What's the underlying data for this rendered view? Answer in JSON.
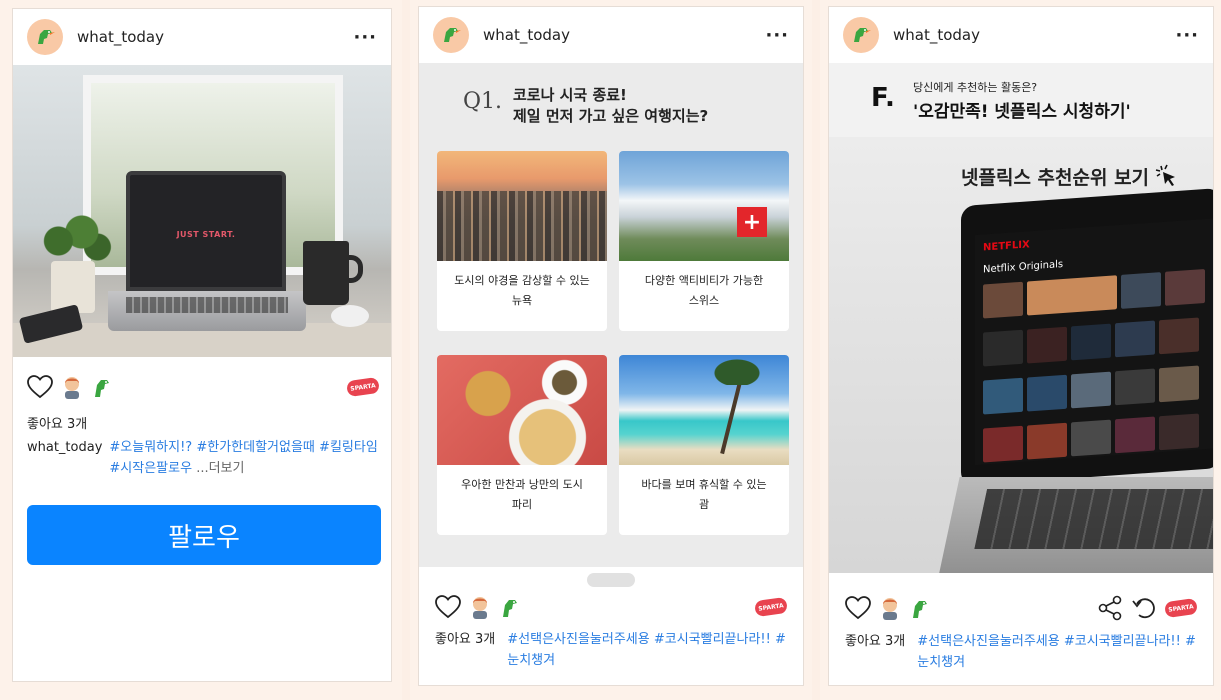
{
  "brand_colors": {
    "follow_button": "#0a84ff",
    "hashtag": "#2a7de1",
    "sparta_badge": "#e8434f",
    "avatar_bg": "#f9c9a6"
  },
  "posts": [
    {
      "username": "what_today",
      "more_label": "···",
      "image_text": "JUST START.",
      "likes_text": "좋아요 3개",
      "caption_user": "what_today",
      "hashtags": [
        "#오늘뭐하지!?",
        "#한가한데할거없을때",
        "#킬링타임",
        "#시작은팔로우"
      ],
      "more_link": "...더보기",
      "follow_label": "팔로우",
      "badge": "SPARTA",
      "icons": [
        "heart-icon",
        "user-avatar-icon",
        "dino-icon"
      ]
    },
    {
      "username": "what_today",
      "more_label": "···",
      "question_number": "Q1.",
      "question_line1": "코로나 시국 종료!",
      "question_line2": "제일 먼저 가고 싶은 여행지는?",
      "options": [
        {
          "line1": "도시의 야경을 감상할 수 있는",
          "line2": "뉴욕"
        },
        {
          "line1": "다양한 액티비티가 가능한",
          "line2": "스위스"
        },
        {
          "line1": "우아한 만찬과 낭만의 도시",
          "line2": "파리"
        },
        {
          "line1": "바다를 보며 휴식할 수 있는",
          "line2": "괌"
        }
      ],
      "likes_text": "좋아요 3개",
      "hashtags": [
        "#선택은사진을눌러주세용",
        "#코시국빨리끝나라!!",
        "#눈치챙겨"
      ],
      "badge": "SPARTA"
    },
    {
      "username": "what_today",
      "more_label": "···",
      "letter": "F.",
      "subtitle": "당신에게 추천하는 활동은?",
      "title": "'오감만족! 넷플릭스 시청하기'",
      "image_caption": "넷플릭스 추천순위 보기",
      "netflix_logo": "NETFLIX",
      "netflix_row_title": "Netflix Originals",
      "likes_text": "좋아요 3개",
      "hashtags": [
        "#선택은사진을눌러주세용",
        "#코시국빨리끝나라!!",
        "#눈치챙겨"
      ],
      "badge": "SPARTA",
      "icons": [
        "heart-icon",
        "user-avatar-icon",
        "dino-icon",
        "share-icon",
        "undo-icon"
      ]
    }
  ]
}
